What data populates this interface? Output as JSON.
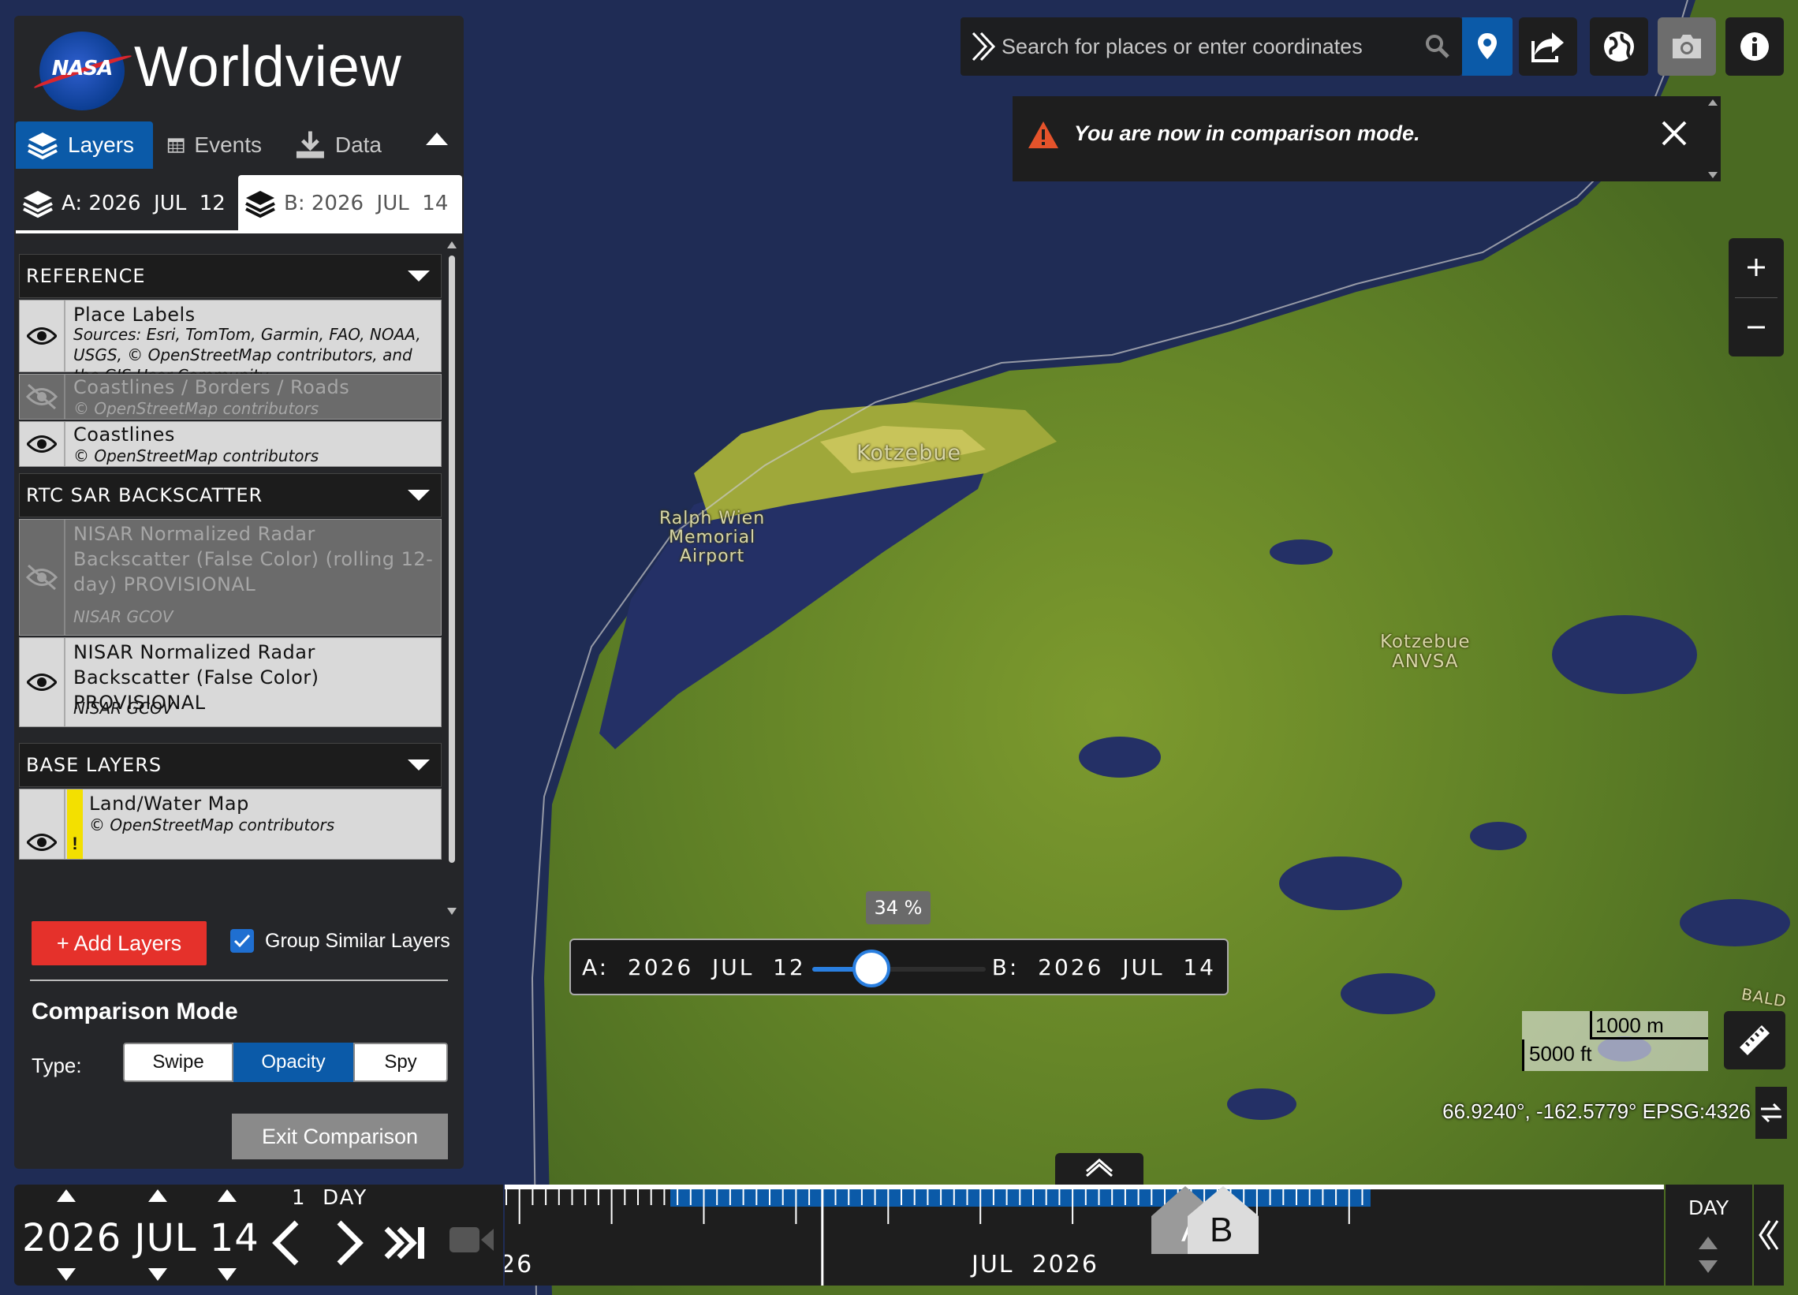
{
  "app": {
    "name": "Worldview",
    "logo_text": "NASA"
  },
  "sidebar": {
    "tabs": [
      {
        "label": "Layers",
        "icon": "layers-icon",
        "active": true
      },
      {
        "label": "Events",
        "icon": "calendar-icon",
        "active": false
      },
      {
        "label": "Data",
        "icon": "download-icon",
        "active": false
      }
    ],
    "date_tabs": {
      "a": "A: 2026  JUL  12",
      "b": "B: 2026  JUL  14",
      "active": "b"
    },
    "groups": [
      {
        "name": "REFERENCE",
        "layers": [
          {
            "title": "Place Labels",
            "source": "Sources: Esri, TomTom, Garmin, FAO, NOAA, USGS, © OpenStreetMap contributors, and the GIS User Community",
            "visible": true
          },
          {
            "title": "Coastlines / Borders / Roads",
            "source": "© OpenStreetMap contributors",
            "visible": false
          },
          {
            "title": "Coastlines",
            "source": "© OpenStreetMap contributors",
            "visible": true
          }
        ]
      },
      {
        "name": "RTC SAR BACKSCATTER",
        "layers": [
          {
            "title": "NISAR Normalized Radar Backscatter (False Color) (rolling 12-day) PROVISIONAL",
            "source": "NISAR GCOV",
            "visible": false
          },
          {
            "title": "NISAR Normalized Radar Backscatter (False Color) PROVISIONAL",
            "source": "NISAR GCOV",
            "visible": true
          }
        ]
      },
      {
        "name": "BASE LAYERS",
        "layers": [
          {
            "title": "Land/Water Map",
            "source": "© OpenStreetMap contributors",
            "visible": true,
            "warning": "!"
          }
        ]
      }
    ],
    "add_layers_label": "+ Add Layers",
    "group_similar_label": "Group Similar Layers",
    "group_similar_checked": true,
    "comparison": {
      "title": "Comparison Mode",
      "type_label": "Type:",
      "options": [
        "Swipe",
        "Opacity",
        "Spy"
      ],
      "selected": "Opacity",
      "exit_label": "Exit Comparison"
    }
  },
  "search": {
    "placeholder": "Search for places or enter coordinates"
  },
  "toolbar": {
    "icons": [
      "location-pin-icon",
      "share-icon",
      "globe-projection-icon",
      "camera-icon",
      "info-icon"
    ]
  },
  "alert": {
    "message": "You are now in comparison mode."
  },
  "map": {
    "labels": {
      "kotzebue": "Kotzebue",
      "airport": [
        "Ralph Wien",
        "Memorial",
        "Airport"
      ],
      "anvsa": [
        "Kotzebue",
        "ANVSA"
      ],
      "edge": "BALD"
    },
    "scale": {
      "metric": "1000 m",
      "imperial": "5000 ft"
    },
    "coordinates": "66.9240°, -162.5779° EPSG:4326"
  },
  "comparison_slider": {
    "percent_label": "34 %",
    "percent": 34,
    "a_label": "A:  2026  JUL  12",
    "b_label": "B:  2026  JUL  14"
  },
  "timeline": {
    "year": "2026",
    "month": "JUL",
    "day": "14",
    "interval": "1  DAY",
    "zoom_level": "DAY",
    "axis_labels": {
      "left_partial": "26",
      "month_year": "JUL  2026"
    },
    "markers": {
      "a": "A",
      "b": "B"
    }
  },
  "colors": {
    "accent": "#0b5aa8",
    "add_button": "#e5312b",
    "land": "#6a8a2a",
    "water": "#1d2a52"
  }
}
